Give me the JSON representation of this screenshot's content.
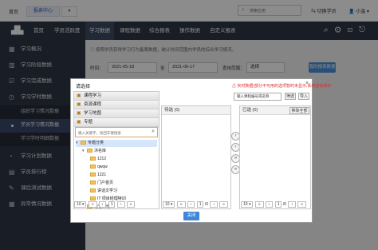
{
  "topbar": {
    "home": "首页",
    "active_tab": "报表中心",
    "dropdown": "▾",
    "search_placeholder": "搜索应用",
    "switch_role": "切换学员",
    "user": "小温"
  },
  "navbar": {
    "items": [
      "首页",
      "学员活跃度",
      "学习数据",
      "课程数据",
      "综合报表",
      "操作数据",
      "自定义报表"
    ]
  },
  "sidebar": {
    "items": [
      "学习概况",
      "学习阶段数据",
      "学习完成数据",
      "学习学时数据"
    ],
    "subitems": [
      "组织学习情况数据",
      "学员学习情况数据",
      "学习学时明细数据"
    ],
    "items2": [
      "学习计划数据",
      "学员排行榜",
      "课后测试数据",
      "异常情况数据"
    ]
  },
  "main": {
    "notice": "按照学员获得学习行为备案数据，统计时间范围内学员的综合学习情况。",
    "filters": {
      "time_label": "时间：",
      "start_date": "2021-05-18",
      "to_label": "至",
      "end_date": "2021-06-17",
      "type_label": "查询范围：",
      "type_value": "选择",
      "range_label": "查询范围：",
      "range_value": "请选择"
    },
    "export_button": "我的报表数据"
  },
  "dialog": {
    "title": "请选择",
    "close": "×",
    "warning": "实时数据(部分不可用的选项暂时未显示,系统自动保存",
    "accordion": [
      "课程学习",
      "资源课程",
      "学习地图",
      "专题"
    ],
    "search_placeholder": "输入关键字，按回车键搜索",
    "tree": {
      "root": "专题分类",
      "child": "沐名库",
      "leaves": [
        "1212",
        "qwqw",
        "1221",
        "门户首页",
        "讲话文学习",
        "IT 项目经理特训"
      ],
      "sibling": "运营类培训"
    },
    "code_input": "输入课程编号或名称",
    "query_button": "筛选",
    "import_button": "导入",
    "pending_label": "待选",
    "pending_count": "(0)",
    "selected_label": "已选",
    "selected_count": "(0)",
    "remove_all": "移除全部",
    "arrows": [
      "›",
      "‹",
      "»",
      "«"
    ],
    "pager_size": "10",
    "pager_page": "1",
    "pager_total": "/0",
    "close_button": "关闭"
  }
}
